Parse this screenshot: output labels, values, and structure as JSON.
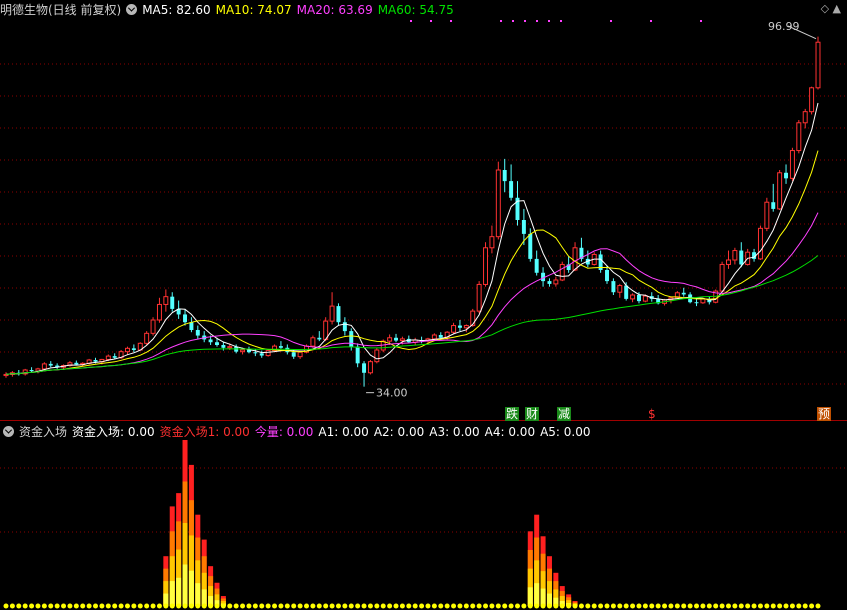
{
  "header": {
    "title": "明德生物(日线 前复权)",
    "ma5": "MA5: 82.60",
    "ma10": "MA10: 74.07",
    "ma20": "MA20: 63.69",
    "ma60": "MA60: 54.75",
    "corner_icons": "◇ ▲"
  },
  "indicator_header": {
    "name": "资金入场",
    "items": [
      {
        "text": "资金入场: 0.00",
        "color": "#ffffff"
      },
      {
        "text": "资金入场1: 0.00",
        "color": "#ff3030"
      },
      {
        "text": "今量: 0.00",
        "color": "#ff40ff"
      },
      {
        "text": "A1: 0.00",
        "color": "#ffffff"
      },
      {
        "text": "A2: 0.00",
        "color": "#ffffff"
      },
      {
        "text": "A3: 0.00",
        "color": "#ffffff"
      },
      {
        "text": "A4: 0.00",
        "color": "#ffffff"
      },
      {
        "text": "A5: 0.00",
        "color": "#ffffff"
      }
    ]
  },
  "annotations": {
    "high": "96.99",
    "low": "34.00"
  },
  "badges": [
    "跌",
    "财",
    "减",
    "$",
    "预"
  ],
  "colors": {
    "up": "#ff3232",
    "down": "#54ffff",
    "ma5": "#ffffff",
    "ma10": "#ffff00",
    "ma20": "#ff40ff",
    "ma60": "#00e000",
    "grid": "#8b0000"
  },
  "chart_data": [
    {
      "type": "candlestick",
      "title": "明德生物(日线 前复权)",
      "price_range": [
        28,
        100
      ],
      "candles_ohlc": [
        [
          36.0,
          36.6,
          35.6,
          36.2
        ],
        [
          36.2,
          36.8,
          35.8,
          36.5
        ],
        [
          36.5,
          37.0,
          36.0,
          36.3
        ],
        [
          36.3,
          37.2,
          36.0,
          37.0
        ],
        [
          37.0,
          37.5,
          36.6,
          36.8
        ],
        [
          36.8,
          37.4,
          36.4,
          37.2
        ],
        [
          37.2,
          38.4,
          37.0,
          38.1
        ],
        [
          38.1,
          38.6,
          37.5,
          37.8
        ],
        [
          37.8,
          38.2,
          37.2,
          37.5
        ],
        [
          37.5,
          38.0,
          37.0,
          37.8
        ],
        [
          37.8,
          38.6,
          37.6,
          38.3
        ],
        [
          38.3,
          38.7,
          37.8,
          38.0
        ],
        [
          38.0,
          38.4,
          37.6,
          38.2
        ],
        [
          38.2,
          39.0,
          38.0,
          38.8
        ],
        [
          38.8,
          39.2,
          38.2,
          38.5
        ],
        [
          38.5,
          39.0,
          38.0,
          38.9
        ],
        [
          38.9,
          39.8,
          38.6,
          39.5
        ],
        [
          39.5,
          40.0,
          38.9,
          39.2
        ],
        [
          39.2,
          40.6,
          39.0,
          40.3
        ],
        [
          40.3,
          41.2,
          39.8,
          40.9
        ],
        [
          40.9,
          41.6,
          40.2,
          40.6
        ],
        [
          40.6,
          42.0,
          40.5,
          41.8
        ],
        [
          41.8,
          44.0,
          41.5,
          43.6
        ],
        [
          43.6,
          46.5,
          43.2,
          46.0
        ],
        [
          46.0,
          50.0,
          45.5,
          48.8
        ],
        [
          48.8,
          51.5,
          47.5,
          50.2
        ],
        [
          50.2,
          51.0,
          47.5,
          48.0
        ],
        [
          48.0,
          49.5,
          46.2,
          47.0
        ],
        [
          47.0,
          48.0,
          45.0,
          45.6
        ],
        [
          45.6,
          46.5,
          43.8,
          44.2
        ],
        [
          44.2,
          45.0,
          42.6,
          43.2
        ],
        [
          43.2,
          44.0,
          42.0,
          42.5
        ],
        [
          42.5,
          43.2,
          41.5,
          42.0
        ],
        [
          42.0,
          42.8,
          41.2,
          41.5
        ],
        [
          41.5,
          42.0,
          40.5,
          41.0
        ],
        [
          41.0,
          41.8,
          40.6,
          41.2
        ],
        [
          41.2,
          41.6,
          40.0,
          40.3
        ],
        [
          40.3,
          41.0,
          39.8,
          40.6
        ],
        [
          40.6,
          41.2,
          40.0,
          40.2
        ],
        [
          40.2,
          40.8,
          39.5,
          40.0
        ],
        [
          40.0,
          40.5,
          39.2,
          39.6
        ],
        [
          39.6,
          40.8,
          39.4,
          40.5
        ],
        [
          40.5,
          41.6,
          40.2,
          41.3
        ],
        [
          41.3,
          42.2,
          40.8,
          41.0
        ],
        [
          41.0,
          41.6,
          39.8,
          40.2
        ],
        [
          40.2,
          40.6,
          39.0,
          39.4
        ],
        [
          39.4,
          40.5,
          39.0,
          40.2
        ],
        [
          40.2,
          41.6,
          40.0,
          41.3
        ],
        [
          41.3,
          43.2,
          41.0,
          42.8
        ],
        [
          42.8,
          44.0,
          42.2,
          42.5
        ],
        [
          42.5,
          46.5,
          42.2,
          45.8
        ],
        [
          45.8,
          51.0,
          45.2,
          48.5
        ],
        [
          48.5,
          49.0,
          45.0,
          45.6
        ],
        [
          45.6,
          46.5,
          43.2,
          44.0
        ],
        [
          44.0,
          44.5,
          40.5,
          41.2
        ],
        [
          41.2,
          41.8,
          37.5,
          38.2
        ],
        [
          38.2,
          38.6,
          34.0,
          36.5
        ],
        [
          36.5,
          38.8,
          36.2,
          38.5
        ],
        [
          38.5,
          41.0,
          38.2,
          40.6
        ],
        [
          40.6,
          42.5,
          40.2,
          42.2
        ],
        [
          42.2,
          43.4,
          41.5,
          42.8
        ],
        [
          42.8,
          43.5,
          42.0,
          42.3
        ],
        [
          42.3,
          43.0,
          41.6,
          42.6
        ],
        [
          42.6,
          43.2,
          41.8,
          42.0
        ],
        [
          42.0,
          42.8,
          41.5,
          42.4
        ],
        [
          42.4,
          43.0,
          41.8,
          42.2
        ],
        [
          42.2,
          42.8,
          41.6,
          42.6
        ],
        [
          42.6,
          43.6,
          42.2,
          43.3
        ],
        [
          43.3,
          43.8,
          42.4,
          42.8
        ],
        [
          42.8,
          44.0,
          42.5,
          43.8
        ],
        [
          43.8,
          45.5,
          43.5,
          45.0
        ],
        [
          45.0,
          46.0,
          44.0,
          44.6
        ],
        [
          44.6,
          45.2,
          43.8,
          45.0
        ],
        [
          45.0,
          48.0,
          44.8,
          47.6
        ],
        [
          47.6,
          53.0,
          47.2,
          52.4
        ],
        [
          52.4,
          60.0,
          52.0,
          59.0
        ],
        [
          59.0,
          63.0,
          58.0,
          61.0
        ],
        [
          61.0,
          74.5,
          60.5,
          73.0
        ],
        [
          73.0,
          75.0,
          69.0,
          71.0
        ],
        [
          71.0,
          74.0,
          67.5,
          68.0
        ],
        [
          68.0,
          71.0,
          63.0,
          64.0
        ],
        [
          64.0,
          66.0,
          59.5,
          61.5
        ],
        [
          61.5,
          62.5,
          56.5,
          57.0
        ],
        [
          57.0,
          58.5,
          54.0,
          54.5
        ],
        [
          54.5,
          55.5,
          52.0,
          53.0
        ],
        [
          53.0,
          53.5,
          52.0,
          52.5
        ],
        [
          52.5,
          53.8,
          52.0,
          53.2
        ],
        [
          53.2,
          56.5,
          53.0,
          56.0
        ],
        [
          56.0,
          57.5,
          54.5,
          55.0
        ],
        [
          55.0,
          60.0,
          54.8,
          59.0
        ],
        [
          59.0,
          60.8,
          56.5,
          57.0
        ],
        [
          57.0,
          58.5,
          55.5,
          56.0
        ],
        [
          56.0,
          58.2,
          55.8,
          57.8
        ],
        [
          57.8,
          58.5,
          54.5,
          55.0
        ],
        [
          55.0,
          55.8,
          52.5,
          53.0
        ],
        [
          53.0,
          53.5,
          50.5,
          51.0
        ],
        [
          51.0,
          52.5,
          50.0,
          52.2
        ],
        [
          52.2,
          52.8,
          49.5,
          49.8
        ],
        [
          49.8,
          50.8,
          49.2,
          50.5
        ],
        [
          50.5,
          51.0,
          49.0,
          49.4
        ],
        [
          49.4,
          50.6,
          49.2,
          50.3
        ],
        [
          50.3,
          51.0,
          49.3,
          49.8
        ],
        [
          49.8,
          50.5,
          48.8,
          49.0
        ],
        [
          49.0,
          49.8,
          48.6,
          49.6
        ],
        [
          49.6,
          50.2,
          49.0,
          50.0
        ],
        [
          50.0,
          51.2,
          49.8,
          50.9
        ],
        [
          50.9,
          51.8,
          50.2,
          50.6
        ],
        [
          50.6,
          51.0,
          49.0,
          49.2
        ],
        [
          49.2,
          49.8,
          48.5,
          49.1
        ],
        [
          49.1,
          50.0,
          48.9,
          49.8
        ],
        [
          49.8,
          50.2,
          48.8,
          49.2
        ],
        [
          49.2,
          51.5,
          49.0,
          51.2
        ],
        [
          51.2,
          56.5,
          51.0,
          56.0
        ],
        [
          56.0,
          58.5,
          55.2,
          56.8
        ],
        [
          56.8,
          59.0,
          56.0,
          58.5
        ],
        [
          58.5,
          60.0,
          55.5,
          56.0
        ],
        [
          56.0,
          58.8,
          55.8,
          58.2
        ],
        [
          58.2,
          58.8,
          56.5,
          57.0
        ],
        [
          57.0,
          63.0,
          56.8,
          62.5
        ],
        [
          62.5,
          68.0,
          62.0,
          67.2
        ],
        [
          67.2,
          70.5,
          65.5,
          66.0
        ],
        [
          66.0,
          73.0,
          65.8,
          72.5
        ],
        [
          72.5,
          74.0,
          70.5,
          71.5
        ],
        [
          71.5,
          77.0,
          71.0,
          76.5
        ],
        [
          76.5,
          82.0,
          76.0,
          81.5
        ],
        [
          81.5,
          84.0,
          80.5,
          83.5
        ],
        [
          83.5,
          88.0,
          83.0,
          87.8
        ],
        [
          87.8,
          97.0,
          87.5,
          96.0
        ]
      ],
      "moving_averages": [
        "MA5",
        "MA10",
        "MA20",
        "MA60"
      ],
      "annotations": [
        "96.99",
        "34.00"
      ]
    },
    {
      "type": "bar",
      "title": "资金入场",
      "bar_range": [
        0,
        100
      ],
      "bursts": [
        {
          "peak_index": 28,
          "values": [
            30,
            60,
            68,
            100,
            85,
            55,
            40,
            24,
            14,
            6
          ]
        },
        {
          "peak_index": 85,
          "values": [
            45,
            55,
            42,
            30,
            20,
            12,
            7,
            3
          ]
        }
      ]
    }
  ]
}
